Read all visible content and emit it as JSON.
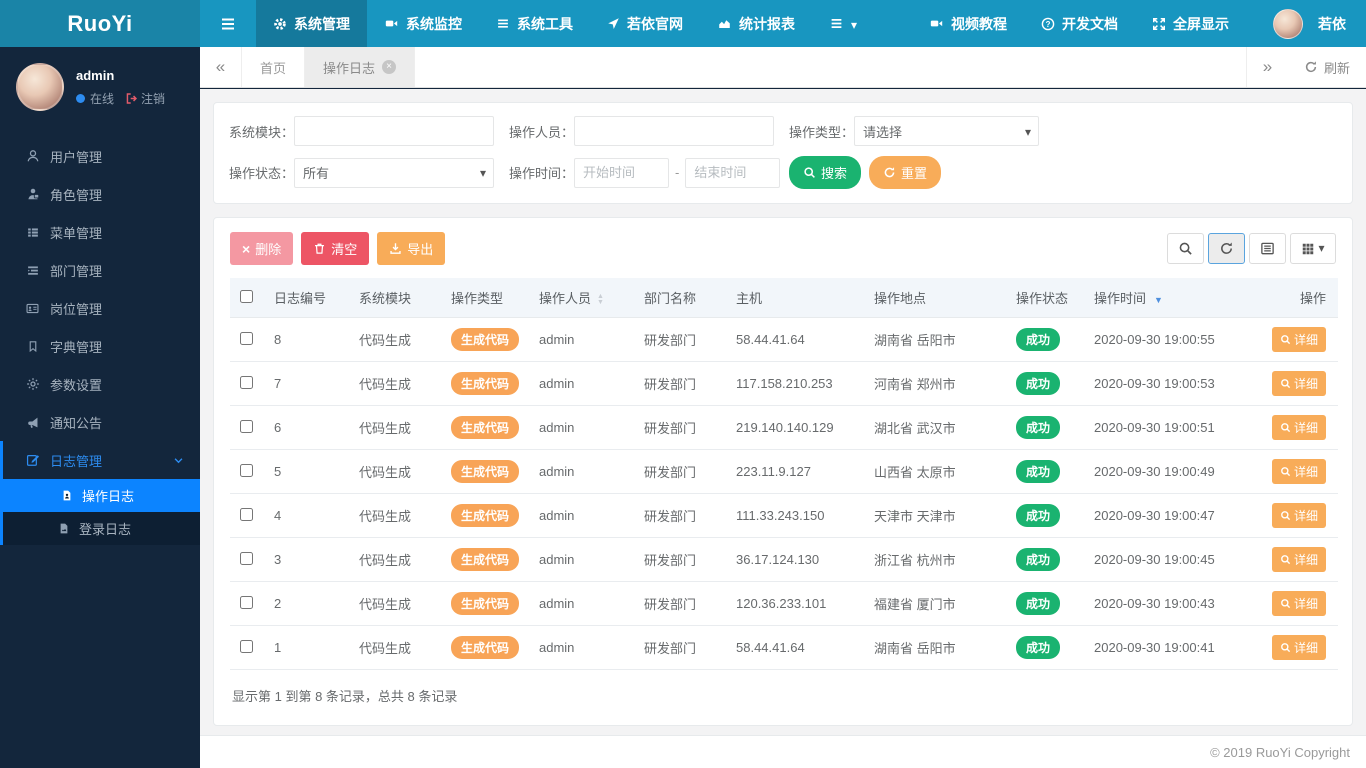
{
  "brand": {
    "logo": "RuoYi",
    "copyright": "© 2019 RuoYi Copyright"
  },
  "topnav": {
    "items": [
      {
        "label": "系统管理",
        "icon": "gear-icon",
        "active": true
      },
      {
        "label": "系统监控",
        "icon": "video-icon"
      },
      {
        "label": "系统工具",
        "icon": "list-icon"
      },
      {
        "label": "若依官网",
        "icon": "location-arrow-icon"
      },
      {
        "label": "统计报表",
        "icon": "chart-icon"
      },
      {
        "label": "",
        "icon": "hamburger-icon",
        "caret": true
      }
    ],
    "right_items": [
      {
        "label": "视频教程",
        "icon": "video-icon"
      },
      {
        "label": "开发文档",
        "icon": "question-icon"
      },
      {
        "label": "全屏显示",
        "icon": "fullscreen-icon"
      }
    ],
    "user_name": "若依"
  },
  "sidebar": {
    "user": {
      "name": "admin",
      "status_label": "在线",
      "logout_label": "注销"
    },
    "menu": [
      {
        "label": "用户管理",
        "icon": "user-icon"
      },
      {
        "label": "角色管理",
        "icon": "role-icon"
      },
      {
        "label": "菜单管理",
        "icon": "menu-list-icon"
      },
      {
        "label": "部门管理",
        "icon": "dept-icon"
      },
      {
        "label": "岗位管理",
        "icon": "idcard-icon"
      },
      {
        "label": "字典管理",
        "icon": "bookmark-icon"
      },
      {
        "label": "参数设置",
        "icon": "settings-icon"
      },
      {
        "label": "通知公告",
        "icon": "megaphone-icon"
      },
      {
        "label": "日志管理",
        "icon": "edit-icon",
        "expanded": true,
        "children": [
          {
            "label": "操作日志",
            "icon": "file-user-icon",
            "active": true
          },
          {
            "label": "登录日志",
            "icon": "file-image-icon"
          }
        ]
      }
    ]
  },
  "tabbar": {
    "home_tab": "首页",
    "active_tab": "操作日志",
    "refresh_label": "刷新"
  },
  "search_form": {
    "module_label": "系统模块：",
    "module_value": "",
    "operator_label": "操作人员：",
    "operator_value": "",
    "type_label": "操作类型：",
    "type_value": "请选择",
    "status_label": "操作状态：",
    "status_value": "所有",
    "time_label": "操作时间：",
    "time_start_placeholder": "开始时间",
    "time_separator": "-",
    "time_end_placeholder": "结束时间",
    "search_button": "搜索",
    "reset_button": "重置"
  },
  "toolbar": {
    "delete_button": "删除",
    "clear_button": "清空",
    "export_button": "导出"
  },
  "table": {
    "columns": [
      {
        "label": "日志编号"
      },
      {
        "label": "系统模块"
      },
      {
        "label": "操作类型"
      },
      {
        "label": "操作人员",
        "sort": "both"
      },
      {
        "label": "部门名称"
      },
      {
        "label": "主机"
      },
      {
        "label": "操作地点"
      },
      {
        "label": "操作状态"
      },
      {
        "label": "操作时间",
        "sort": "desc"
      },
      {
        "label": "操作"
      }
    ],
    "rows": [
      {
        "id": "8",
        "module": "代码生成",
        "type_badge": "生成代码",
        "operator": "admin",
        "dept": "研发部门",
        "host": "58.44.41.64",
        "location": "湖南省 岳阳市",
        "status_badge": "成功",
        "time": "2020-09-30 19:00:55",
        "action": "详细"
      },
      {
        "id": "7",
        "module": "代码生成",
        "type_badge": "生成代码",
        "operator": "admin",
        "dept": "研发部门",
        "host": "117.158.210.253",
        "location": "河南省 郑州市",
        "status_badge": "成功",
        "time": "2020-09-30 19:00:53",
        "action": "详细"
      },
      {
        "id": "6",
        "module": "代码生成",
        "type_badge": "生成代码",
        "operator": "admin",
        "dept": "研发部门",
        "host": "219.140.140.129",
        "location": "湖北省 武汉市",
        "status_badge": "成功",
        "time": "2020-09-30 19:00:51",
        "action": "详细"
      },
      {
        "id": "5",
        "module": "代码生成",
        "type_badge": "生成代码",
        "operator": "admin",
        "dept": "研发部门",
        "host": "223.11.9.127",
        "location": "山西省 太原市",
        "status_badge": "成功",
        "time": "2020-09-30 19:00:49",
        "action": "详细"
      },
      {
        "id": "4",
        "module": "代码生成",
        "type_badge": "生成代码",
        "operator": "admin",
        "dept": "研发部门",
        "host": "111.33.243.150",
        "location": "天津市 天津市",
        "status_badge": "成功",
        "time": "2020-09-30 19:00:47",
        "action": "详细"
      },
      {
        "id": "3",
        "module": "代码生成",
        "type_badge": "生成代码",
        "operator": "admin",
        "dept": "研发部门",
        "host": "36.17.124.130",
        "location": "浙江省 杭州市",
        "status_badge": "成功",
        "time": "2020-09-30 19:00:45",
        "action": "详细"
      },
      {
        "id": "2",
        "module": "代码生成",
        "type_badge": "生成代码",
        "operator": "admin",
        "dept": "研发部门",
        "host": "120.36.233.101",
        "location": "福建省 厦门市",
        "status_badge": "成功",
        "time": "2020-09-30 19:00:43",
        "action": "详细"
      },
      {
        "id": "1",
        "module": "代码生成",
        "type_badge": "生成代码",
        "operator": "admin",
        "dept": "研发部门",
        "host": "58.44.41.64",
        "location": "湖南省 岳阳市",
        "status_badge": "成功",
        "time": "2020-09-30 19:00:41",
        "action": "详细"
      }
    ]
  },
  "pagination": {
    "summary": "显示第 1 到第 8 条记录，总共 8 条记录"
  }
}
